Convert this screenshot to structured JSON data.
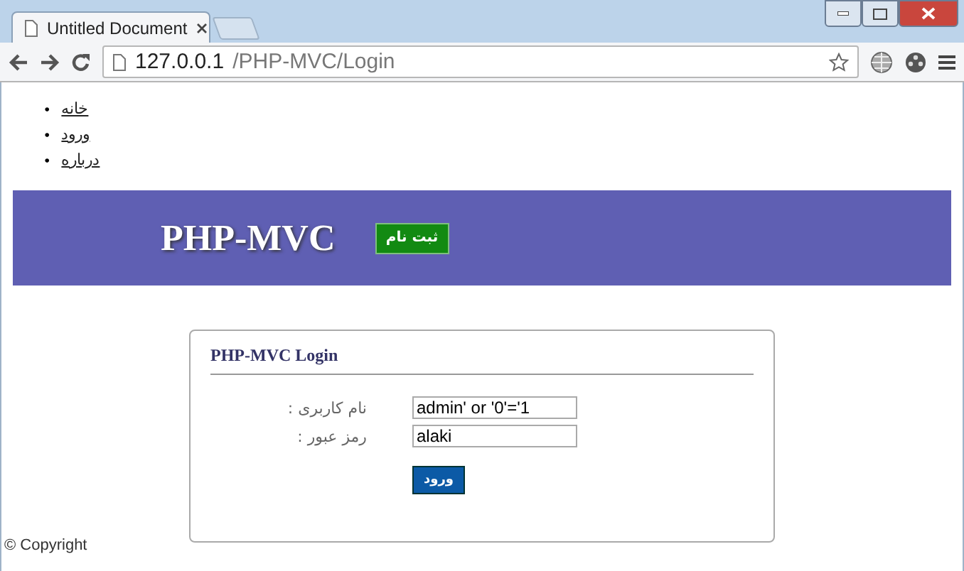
{
  "browser": {
    "tabs": [
      {
        "title": "Untitled Document",
        "selected": true
      }
    ],
    "url_host": "127.0.0.1",
    "url_path": "/PHP-MVC/Login"
  },
  "nav": [
    {
      "marker": "•",
      "label": "خانه"
    },
    {
      "marker": "•",
      "label": "ورود"
    },
    {
      "marker": "•",
      "label": "درباره"
    }
  ],
  "header": {
    "title": "PHP-MVC",
    "register_button": "ثبت نام"
  },
  "login": {
    "title": "PHP-MVC Login",
    "fields": [
      {
        "label": "نام کاربری :",
        "value": "admin' or '0'='1"
      },
      {
        "label": "رمز عبور :",
        "value": "alaki"
      }
    ],
    "submit": "ورود"
  },
  "footer": "© Copyright"
}
